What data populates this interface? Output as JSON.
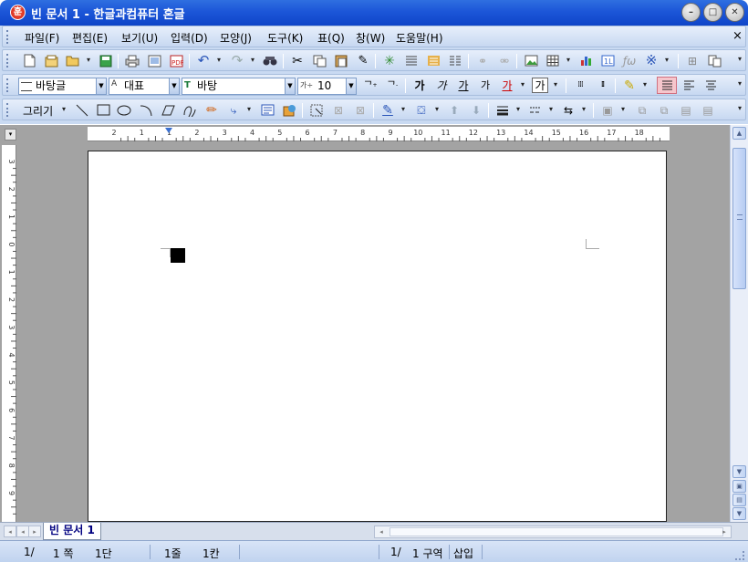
{
  "window": {
    "title": "빈 문서 1 - 한글과컴퓨터 혼글",
    "app_icon_glyph": "훈",
    "buttons": {
      "minimize": "–",
      "maximize": "□",
      "close": "✕"
    }
  },
  "menu": {
    "items": [
      "파일(F)",
      "편집(E)",
      "보기(U)",
      "입력(D)",
      "모양(J)",
      "도구(K)",
      "표(Q)",
      "창(W)",
      "도움말(H)"
    ],
    "close_doc": "×"
  },
  "format_bar": {
    "style": "바탕글",
    "lang": "대표",
    "font": "바탕",
    "size": "10",
    "size_prefix": "가÷"
  },
  "draw_bar": {
    "label": "그리기"
  },
  "ruler": {
    "h_ticks": [
      "2",
      "1",
      "1",
      "2",
      "3",
      "4",
      "5",
      "6",
      "7",
      "8",
      "9",
      "10",
      "11",
      "12",
      "13",
      "14",
      "15",
      "16",
      "17",
      "18"
    ],
    "v_ticks": [
      "3",
      "2",
      "1",
      "0",
      "1",
      "2",
      "3",
      "4",
      "5",
      "6",
      "7",
      "8",
      "9"
    ]
  },
  "tabs": {
    "doc": "빈 문서 1"
  },
  "status": {
    "page": "1/",
    "page_count": "1 쪽",
    "column": "1단",
    "line": "1줄",
    "char": "1칸",
    "section": "1/",
    "section_count": "1 구역",
    "mode": "삽입"
  },
  "colors": {
    "title_blue": "#1c56d8",
    "toolbar_bg": "#c9daf2",
    "workspace_gray": "#a3a3a3",
    "active_button": "#f6c6cc"
  }
}
